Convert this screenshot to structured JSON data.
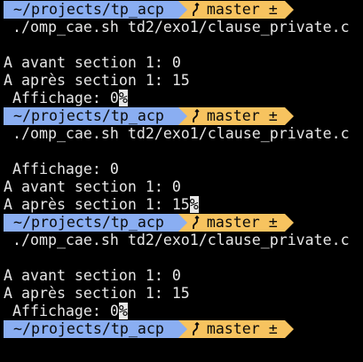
{
  "colors": {
    "path_segment": "#8aaef2",
    "git_segment": "#f7c35f",
    "cursor": "#f7c35f",
    "text": "#e6e6e6",
    "background": "#000000"
  },
  "prompt": {
    "path": " ~/projects/tp_acp ",
    "branch": "master ±",
    "branch_icon": "git-branch-icon"
  },
  "blocks": [
    {
      "command": " ./omp_cae.sh td2/exo1/clause_private.c",
      "output": [
        "A avant section 1: 0",
        "A après section 1: 15",
        " Affichage: 0"
      ],
      "eol_mark": "%"
    },
    {
      "command": " ./omp_cae.sh td2/exo1/clause_private.c",
      "output": [
        " Affichage: 0",
        "A avant section 1: 0",
        "A après section 1: 15"
      ],
      "eol_mark": "%"
    },
    {
      "command": " ./omp_cae.sh td2/exo1/clause_private.c",
      "output": [
        "A avant section 1: 0",
        "A après section 1: 15",
        " Affichage: 0"
      ],
      "eol_mark": "%"
    }
  ]
}
